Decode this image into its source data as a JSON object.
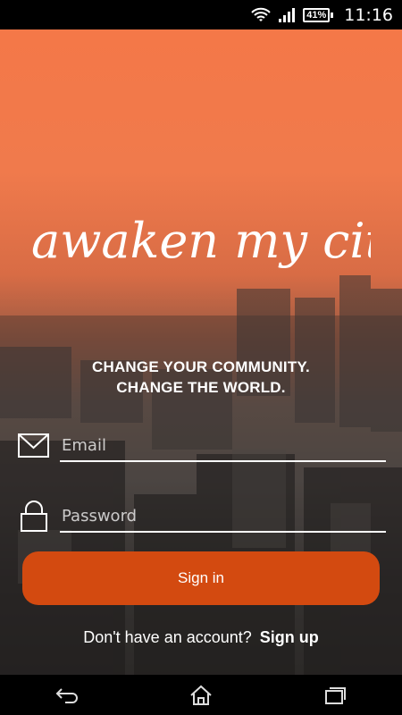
{
  "status_bar": {
    "battery": "41%",
    "time": "11:16",
    "icons": [
      "wifi-icon",
      "signal-icon",
      "battery-icon"
    ]
  },
  "app": {
    "logo_text": "awaken my city",
    "tagline_line1": "CHANGE YOUR COMMUNITY.",
    "tagline_line2": "CHANGE THE WORLD."
  },
  "form": {
    "email_placeholder": "Email",
    "password_placeholder": "Password",
    "signin_label": "Sign in"
  },
  "footer": {
    "prompt": "Don't have an account?",
    "signup_label": "Sign up"
  },
  "colors": {
    "accent": "#d34a10",
    "top_background": "#f47848"
  },
  "nav_bar": {
    "icons": [
      "back-icon",
      "home-icon",
      "recent-apps-icon"
    ]
  }
}
